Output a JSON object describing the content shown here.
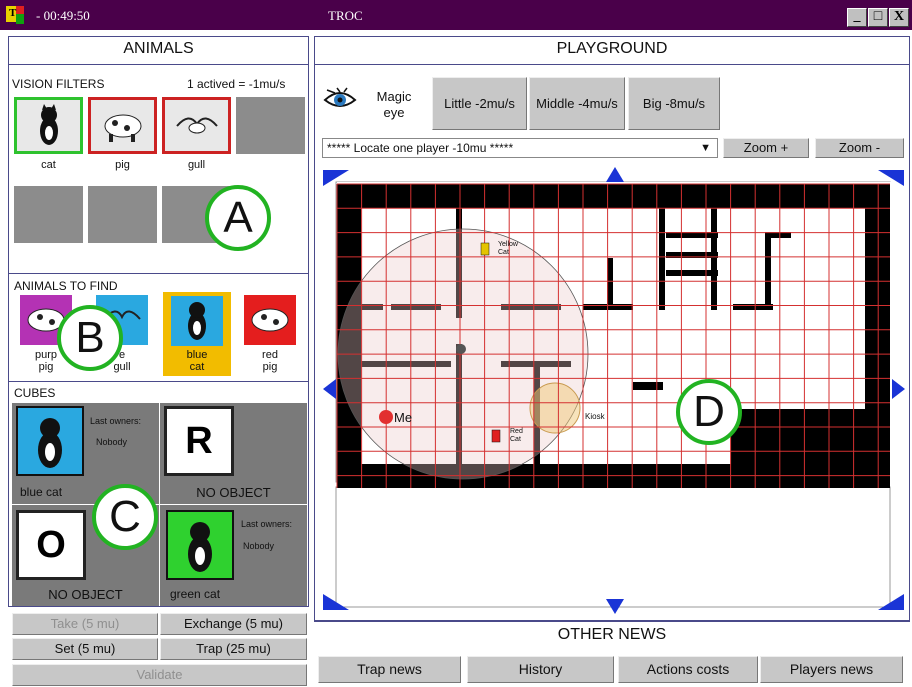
{
  "window": {
    "app_title": "TROC",
    "time": "- 00:49:50",
    "logo_letter": "T",
    "btn_min": "_",
    "btn_max": "□",
    "btn_close": "X"
  },
  "animals": {
    "header": "ANIMALS",
    "vision_filters": {
      "title": "VISION FILTERS",
      "status": "1 actived = -1mu/s",
      "items": [
        {
          "label": "cat"
        },
        {
          "label": "pig"
        },
        {
          "label": "gull"
        }
      ]
    },
    "to_find": {
      "title": "ANIMALS TO FIND",
      "items": [
        {
          "line1": "purple",
          "line2": "pig",
          "visible1": "purp"
        },
        {
          "line1": "blue",
          "line2": "gull",
          "visible1": "e"
        },
        {
          "line1": "blue",
          "line2": "cat"
        },
        {
          "line1": "red",
          "line2": "pig"
        }
      ]
    }
  },
  "cubes": {
    "title": "CUBES",
    "slots": [
      {
        "label": "blue cat",
        "owners_label": "Last owners:",
        "owners": "Nobody"
      },
      {
        "letter": "R",
        "label": "NO OBJECT"
      },
      {
        "letter": "O",
        "label": "NO OBJECT"
      },
      {
        "label": "green cat",
        "owners_label": "Last owners:",
        "owners": "Nobody"
      }
    ]
  },
  "actions": {
    "take": "Take (5 mu)",
    "exchange": "Exchange (5 mu)",
    "set": "Set (5 mu)",
    "trap": "Trap (25 mu)",
    "validate": "Validate"
  },
  "playground": {
    "header": "PLAYGROUND",
    "magic_eye": "Magic eye",
    "little": "Little -2mu/s",
    "middle": "Middle -4mu/s",
    "big": "Big -8mu/s",
    "locate": "***** Locate one player -10mu *****",
    "zoom_in": "Zoom +",
    "zoom_out": "Zoom -",
    "map_labels": {
      "yellow_cat": "Yellow Cat",
      "red_cat": "Red Cat",
      "me": "Me",
      "kiosk": "Kiosk"
    }
  },
  "callouts": {
    "a": "A",
    "b": "B",
    "c": "C",
    "d": "D"
  },
  "news": {
    "header": "OTHER NEWS",
    "tabs": [
      "Trap news",
      "History",
      "Actions costs",
      "Players news"
    ]
  },
  "colors": {
    "titlebar": "#4a004a",
    "map_line": "#d43030",
    "wall": "#000000",
    "callout_ring": "#22b322",
    "tile_gray": "#8c8c8c",
    "arrow": "#1a34d6"
  }
}
